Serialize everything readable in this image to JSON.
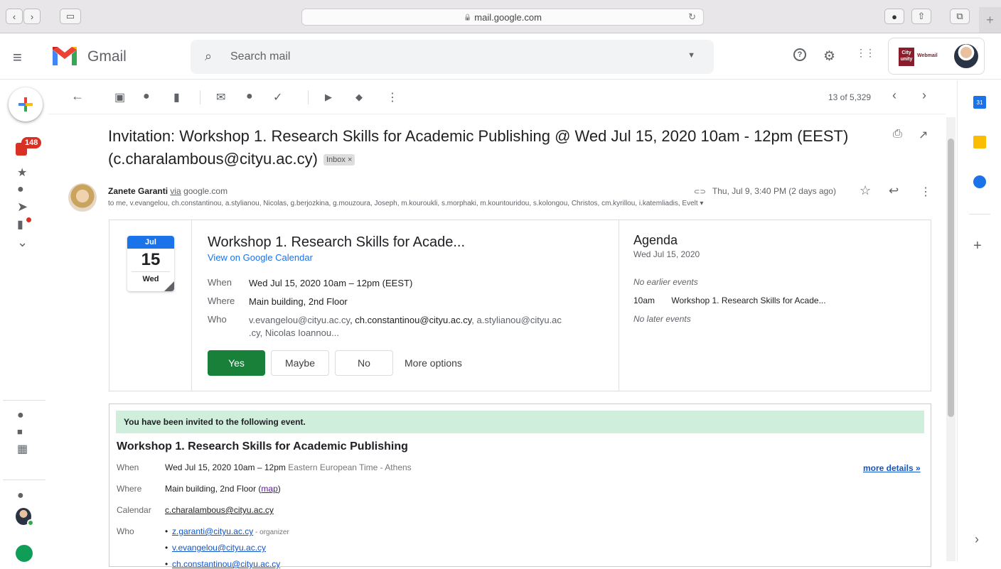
{
  "browser": {
    "url": "mail.google.com",
    "reload_glyph": "↻",
    "back_glyph": "‹",
    "forward_glyph": "›",
    "sidebar_glyph": "▭",
    "download_glyph": "●",
    "share_glyph": "⇧",
    "tabs_glyph": "⧉",
    "new_tab_glyph": "+",
    "lock_glyph": "🔒"
  },
  "header": {
    "app_name": "Gmail",
    "search_placeholder": "Search mail",
    "menu_glyph": "≡",
    "search_glyph": "⌕",
    "dropdown_glyph": "▼",
    "help_glyph": "?",
    "settings_glyph": "⚙",
    "apps_glyph": "⋮⋮",
    "account_logo_text": "City unity",
    "account_label": "Webmail"
  },
  "left_rail": {
    "unread_badge": "148",
    "star_glyph": "★",
    "clock_glyph": "●",
    "send_glyph": "➤",
    "draft_glyph": "▮",
    "expand_glyph": "⌄",
    "chat_glyph": "●",
    "video_glyph": "■",
    "keyboard_glyph": "▦",
    "hangouts_glyph": "●"
  },
  "toolbar": {
    "back_glyph": "←",
    "archive_glyph": "▣",
    "spam_glyph": "●",
    "delete_glyph": "▮",
    "mark_unread_glyph": "✉",
    "snooze_glyph": "●",
    "add_task_glyph": "✓",
    "move_glyph": "▶",
    "label_glyph": "◆",
    "more_glyph": "⋮",
    "pager": "13 of 5,329",
    "prev_glyph": "‹",
    "next_glyph": "›"
  },
  "email": {
    "subject": "Invitation: Workshop 1. Research Skills for Academic Publishing @ Wed Jul 15, 2020 10am - 12pm (EEST) (c.charalambous@cityu.ac.cy)",
    "label_chip": "Inbox ×",
    "print_glyph": "⎙",
    "popout_glyph": "↗",
    "sender_name": "Zanete Garanti",
    "sender_via": "via",
    "sender_domain": "google.com",
    "recipients": "to me, v.evangelou, ch.constantinou, a.stylianou, Nicolas, g.berjozkina, g.mouzoura, Joseph, m.kouroukli, s.morphaki, m.kountouridou, s.kolongou, Christos, cm.kyrillou, i.katemliadis, Evelt ▾",
    "attach_glyph": "⊂⊃",
    "date": "Thu, Jul 9, 3:40 PM (2 days ago)",
    "star_glyph": "☆",
    "reply_glyph": "↩",
    "more_glyph": "⋮"
  },
  "card": {
    "cal_month": "Jul",
    "cal_day": "15",
    "cal_dow": "Wed",
    "title": "Workshop 1. Research Skills for Acade...",
    "view_link": "View on Google Calendar",
    "when_label": "When",
    "when_value": "Wed Jul 15, 2020 10am – 12pm (EEST)",
    "where_label": "Where",
    "where_value": "Main building, 2nd Floor",
    "who_label": "Who",
    "who_part1": "v.evangelou@cityu.ac.cy",
    "who_part2": ", ch.constantinou@cityu.ac.cy",
    "who_part3": ", a.stylianou@cityu.ac",
    "who_part4": ".cy, Nicolas Ioannou...",
    "yes": "Yes",
    "maybe": "Maybe",
    "no": "No",
    "more_options": "More options",
    "agenda_title": "Agenda",
    "agenda_date": "Wed Jul 15, 2020",
    "no_earlier": "No earlier events",
    "agenda_time": "10am",
    "agenda_event": "Workshop 1. Research Skills for Acade...",
    "no_later": "No later events"
  },
  "invite": {
    "banner": "You have been invited to the following event.",
    "title": "Workshop 1. Research Skills for Academic Publishing",
    "when_label": "When",
    "when_value": "Wed Jul 15, 2020 10am – 12pm",
    "when_tz": "Eastern European Time - Athens",
    "more_details": "more details »",
    "where_label": "Where",
    "where_value": "Main building, 2nd Floor",
    "map_open": "(",
    "map_link": "map",
    "map_close": ")",
    "calendar_label": "Calendar",
    "calendar_value": "c.charalambous@cityu.ac.cy",
    "who_label": "Who",
    "bullet": "•",
    "who_list": [
      {
        "email": "z.garanti@cityu.ac.cy",
        "note": " - organizer"
      },
      {
        "email": "v.evangelou@cityu.ac.cy",
        "note": ""
      },
      {
        "email": "ch.constantinou@cityu.ac.cy",
        "note": ""
      }
    ]
  },
  "right_panel": {
    "calendar_day": "31",
    "add_glyph": "+",
    "collapse_glyph": "›"
  },
  "colors": {
    "yes_green": "#188038",
    "badge_red": "#d93025",
    "link_blue": "#1a73e8",
    "banner_green": "#cfeedb"
  }
}
